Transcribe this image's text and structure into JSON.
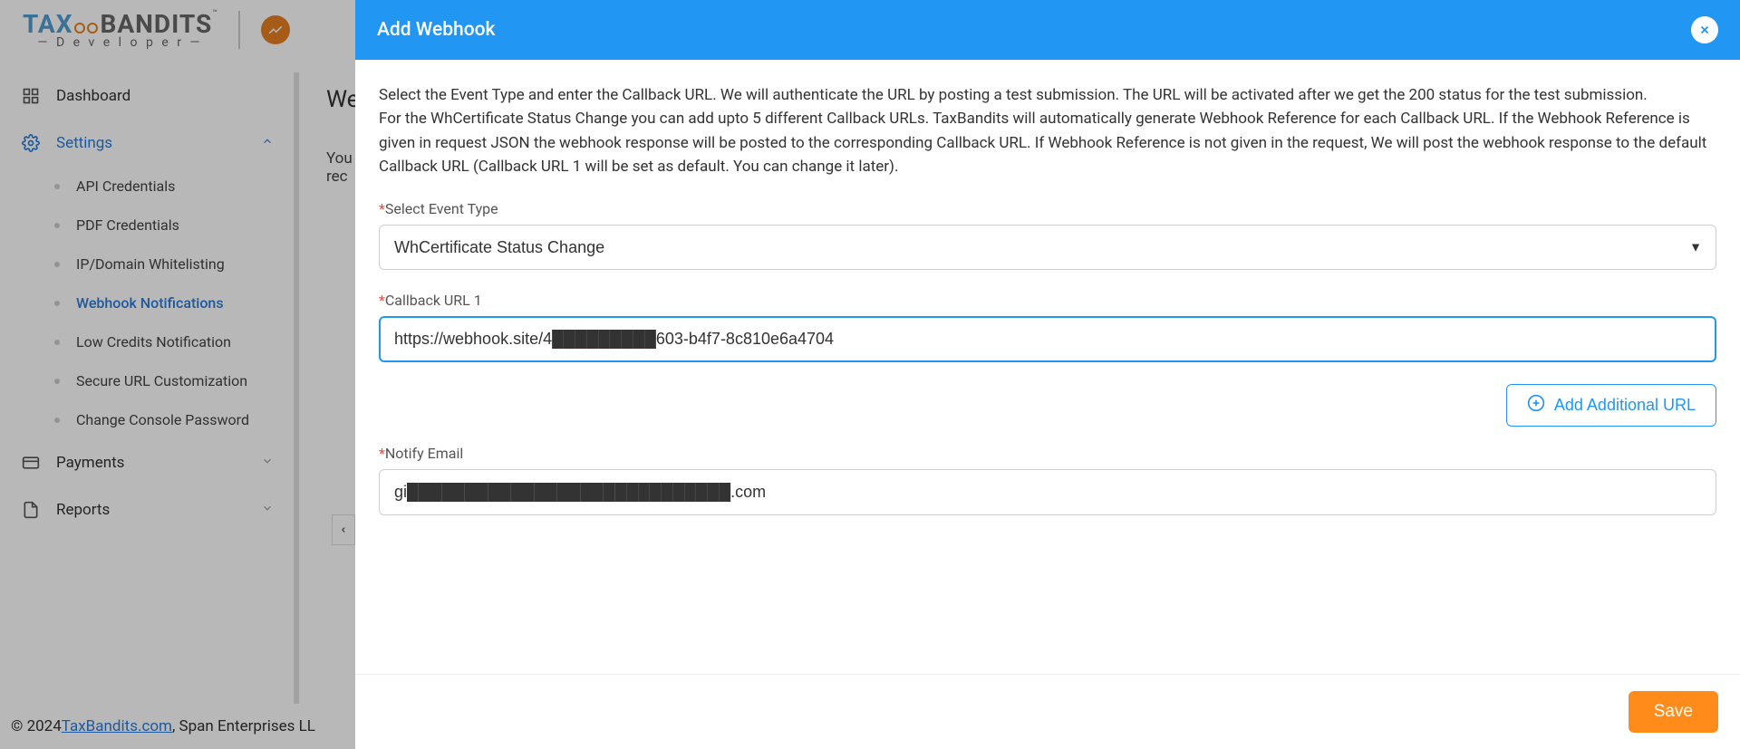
{
  "brand": {
    "name_part1": "TAX",
    "name_part2": "BANDITS",
    "subline": "— D e v e l o p e r —",
    "tm": "™"
  },
  "sidebar": {
    "items": [
      {
        "label": "Dashboard",
        "icon": "dashboard-icon"
      },
      {
        "label": "Settings",
        "icon": "settings-icon",
        "expanded": true
      },
      {
        "label": "Payments",
        "icon": "payments-icon"
      },
      {
        "label": "Reports",
        "icon": "reports-icon"
      }
    ],
    "settings_sub": [
      {
        "label": "API Credentials"
      },
      {
        "label": "PDF Credentials"
      },
      {
        "label": "IP/Domain Whitelisting"
      },
      {
        "label": "Webhook Notifications",
        "active": true
      },
      {
        "label": "Low Credits Notification"
      },
      {
        "label": "Secure URL Customization"
      },
      {
        "label": "Change Console Password"
      }
    ]
  },
  "page": {
    "title_partial": "We",
    "desc_line1": "You",
    "desc_line2": "rec"
  },
  "footer": {
    "copyright": "© 2024 ",
    "link": "TaxBandits.com",
    "company": ", Span Enterprises LL"
  },
  "modal": {
    "title": "Add Webhook",
    "description_p1": "Select the Event Type and enter the Callback URL. We will authenticate the URL by posting a test submission. The URL will be activated after we get the 200 status for the test submission.",
    "description_p2": "For the WhCertificate Status Change you can add upto 5 different Callback URLs. TaxBandits will automatically generate Webhook Reference for each Callback URL. If the Webhook Reference is given in request JSON the webhook response will be posted to the corresponding Callback URL. If Webhook Reference is not given in the request, We will post the webhook response to the default Callback URL (Callback URL 1 will be set as default. You can change it later).",
    "event_type_label": "Select Event Type",
    "event_type_value": "WhCertificate Status Change",
    "callback_label": "Callback URL 1",
    "callback_value": "https://webhook.site/4█████████603-b4f7-8c810e6a4704",
    "add_url_label": "Add Additional URL",
    "notify_email_label": "Notify Email",
    "notify_email_value": "gi████████████████████████████.com",
    "save_label": "Save"
  }
}
